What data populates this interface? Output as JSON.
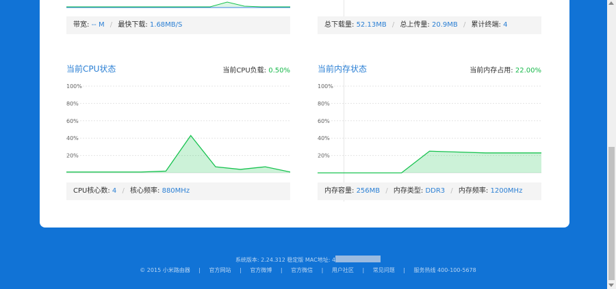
{
  "top": {
    "left_bar": {
      "bandwidth_label": "带宽:",
      "bandwidth_value": "-- M",
      "max_down_label": "最快下载:",
      "max_down_value": "1.68MB/S"
    },
    "right_bar": {
      "total_down_label": "总下载量:",
      "total_down_value": "52.13MB",
      "total_up_label": "总上传量:",
      "total_up_value": "20.9MB",
      "devices_label": "累计终端:",
      "devices_value": "4"
    }
  },
  "cpu": {
    "title": "当前CPU状态",
    "stat_label": "当前CPU负载:",
    "stat_value": "0.50%",
    "cores_label": "CPU核心数:",
    "cores_value": "4",
    "freq_label": "核心频率:",
    "freq_value": "880MHz"
  },
  "mem": {
    "title": "当前内存状态",
    "stat_label": "当前内存占用:",
    "stat_value": "22.00%",
    "capacity_label": "内存容量:",
    "capacity_value": "256MB",
    "type_label": "内存类型:",
    "type_value": "DDR3",
    "freq_label": "内存频率:",
    "freq_value": "1200MHz"
  },
  "chart_data": [
    {
      "type": "area",
      "name": "cpu",
      "y_ticks": [
        "100%",
        "80%",
        "60%",
        "40%",
        "20%"
      ],
      "ylim": [
        0,
        100
      ],
      "values": [
        1,
        1,
        1,
        1,
        2,
        43,
        7,
        4,
        7,
        1
      ],
      "color": "#17c24f"
    },
    {
      "type": "area",
      "name": "memory",
      "y_ticks": [
        "100%",
        "80%",
        "60%",
        "40%",
        "20%"
      ],
      "ylim": [
        0,
        100
      ],
      "values": [
        0,
        0,
        0,
        0,
        25,
        24,
        23,
        23,
        23
      ],
      "color": "#17c24f"
    }
  ],
  "footer": {
    "version_label": "系统版本: 2.24.312 稳定版",
    "mac_label": "MAC地址: 4",
    "copyright": "© 2015 小米路由器",
    "links": [
      "官方网站",
      "官方微博",
      "官方微信",
      "用户社区",
      "常见问题"
    ],
    "hotline": "服务热线 400-100-5678"
  },
  "colors": {
    "background": "#1173d6",
    "accent": "#2a7fd4",
    "good": "#17b84a"
  }
}
